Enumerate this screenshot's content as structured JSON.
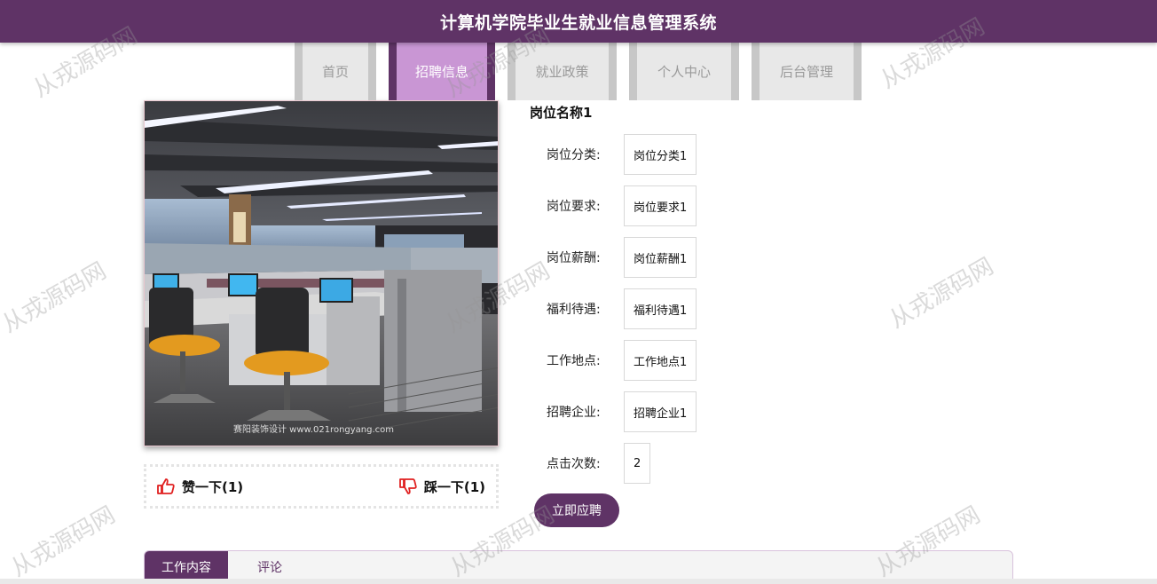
{
  "header": {
    "title": "计算机学院毕业生就业信息管理系统"
  },
  "nav": {
    "items": [
      {
        "label": "首页"
      },
      {
        "label": "招聘信息"
      },
      {
        "label": "就业政策"
      },
      {
        "label": "个人中心"
      },
      {
        "label": "后台管理"
      }
    ],
    "active_index": 1
  },
  "watermark": {
    "text": "从戎源码网"
  },
  "photo": {
    "caption": "赛阳装饰设计 www.021rongyang.com"
  },
  "votes": {
    "like_label": "赞一下(1)",
    "dislike_label": "踩一下(1)"
  },
  "job": {
    "title": "岗位名称1",
    "fields": [
      {
        "label": "岗位分类:",
        "value": "岗位分类1"
      },
      {
        "label": "岗位要求:",
        "value": "岗位要求1"
      },
      {
        "label": "岗位薪酬:",
        "value": "岗位薪酬1"
      },
      {
        "label": "福利待遇:",
        "value": "福利待遇1"
      },
      {
        "label": "工作地点:",
        "value": "工作地点1"
      },
      {
        "label": "招聘企业:",
        "value": "招聘企业1"
      },
      {
        "label": "点击次数:",
        "value": "2"
      }
    ],
    "apply_label": "立即应聘"
  },
  "tabs": {
    "items": [
      {
        "label": "工作内容"
      },
      {
        "label": "评论"
      }
    ],
    "active_index": 0
  },
  "colors": {
    "primary": "#5f3366",
    "nav_active": "#c996d4",
    "thumb_icon": "#e02020"
  }
}
